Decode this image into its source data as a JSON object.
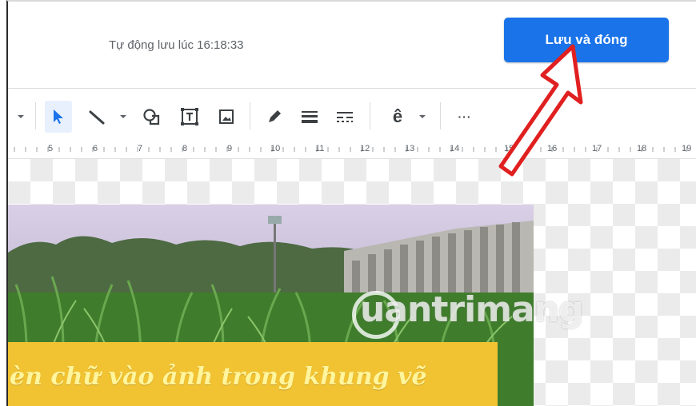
{
  "header": {
    "autosave_text": "Tự động lưu lúc 16:18:33",
    "save_close_label": "Lưu và đóng"
  },
  "toolbar": {
    "items": [
      {
        "name": "zoom-dropdown-icon"
      },
      {
        "name": "select-cursor-icon"
      },
      {
        "name": "line-icon"
      },
      {
        "name": "line-dropdown-icon"
      },
      {
        "name": "shape-icon"
      },
      {
        "name": "text-box-icon"
      },
      {
        "name": "image-icon"
      },
      {
        "name": "pencil-icon"
      },
      {
        "name": "line-weight-icon"
      },
      {
        "name": "line-dash-icon"
      },
      {
        "name": "font-icon"
      },
      {
        "name": "font-dropdown-icon"
      },
      {
        "name": "more-icon"
      }
    ],
    "font_glyph": "ê",
    "more_glyph": "···"
  },
  "ruler": {
    "labels": [
      "5",
      "6",
      "7",
      "8",
      "9",
      "10",
      "11",
      "12",
      "13",
      "14",
      "15",
      "16",
      "17",
      "18",
      "19"
    ]
  },
  "canvas": {
    "banner_text": "èn chữ vào ảnh trong khung vẽ",
    "watermark_text": "uantrimang"
  },
  "colors": {
    "accent": "#1a73e8",
    "banner": "#f1c232",
    "arrow": "#e02020"
  }
}
